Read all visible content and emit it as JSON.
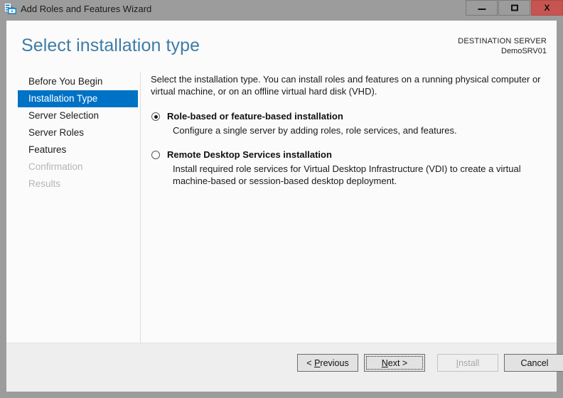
{
  "window": {
    "title": "Add Roles and Features Wizard",
    "icon": "server-roles-icon",
    "controls": {
      "minimize": "minimize-icon",
      "maximize": "maximize-icon",
      "close": "X"
    }
  },
  "header": {
    "page_title": "Select installation type",
    "destination_label": "DESTINATION SERVER",
    "destination_value": "DemoSRV01"
  },
  "sidebar": {
    "items": [
      {
        "label": "Before You Begin",
        "state": "normal"
      },
      {
        "label": "Installation Type",
        "state": "selected"
      },
      {
        "label": "Server Selection",
        "state": "normal"
      },
      {
        "label": "Server Roles",
        "state": "normal"
      },
      {
        "label": "Features",
        "state": "normal"
      },
      {
        "label": "Confirmation",
        "state": "disabled"
      },
      {
        "label": "Results",
        "state": "disabled"
      }
    ]
  },
  "main": {
    "intro": "Select the installation type. You can install roles and features on a running physical computer or virtual machine, or on an offline virtual hard disk (VHD).",
    "options": [
      {
        "label": "Role-based or feature-based installation",
        "description": "Configure a single server by adding roles, role services, and features.",
        "selected": true
      },
      {
        "label": "Remote Desktop Services installation",
        "description": "Install required role services for Virtual Desktop Infrastructure (VDI) to create a virtual machine-based or session-based desktop deployment.",
        "selected": false
      }
    ]
  },
  "footer": {
    "buttons": [
      {
        "name": "previous",
        "prefix": "< ",
        "mnemonic": "P",
        "suffix": "revious",
        "enabled": true,
        "focused": false
      },
      {
        "name": "next",
        "prefix": "",
        "mnemonic": "N",
        "suffix": "ext >",
        "enabled": true,
        "focused": true
      },
      {
        "name": "install",
        "prefix": "",
        "mnemonic": "I",
        "suffix": "nstall",
        "enabled": false,
        "focused": false
      },
      {
        "name": "cancel",
        "prefix": "",
        "mnemonic": "",
        "suffix": "Cancel",
        "enabled": true,
        "focused": false
      }
    ]
  },
  "colors": {
    "titlebar": "#9c9c9c",
    "accent": "#0072c6",
    "heading": "#3e7ca6",
    "close_button": "#c75450",
    "footer_bg": "#eeeeee",
    "client_bg": "#fbfbfb"
  }
}
